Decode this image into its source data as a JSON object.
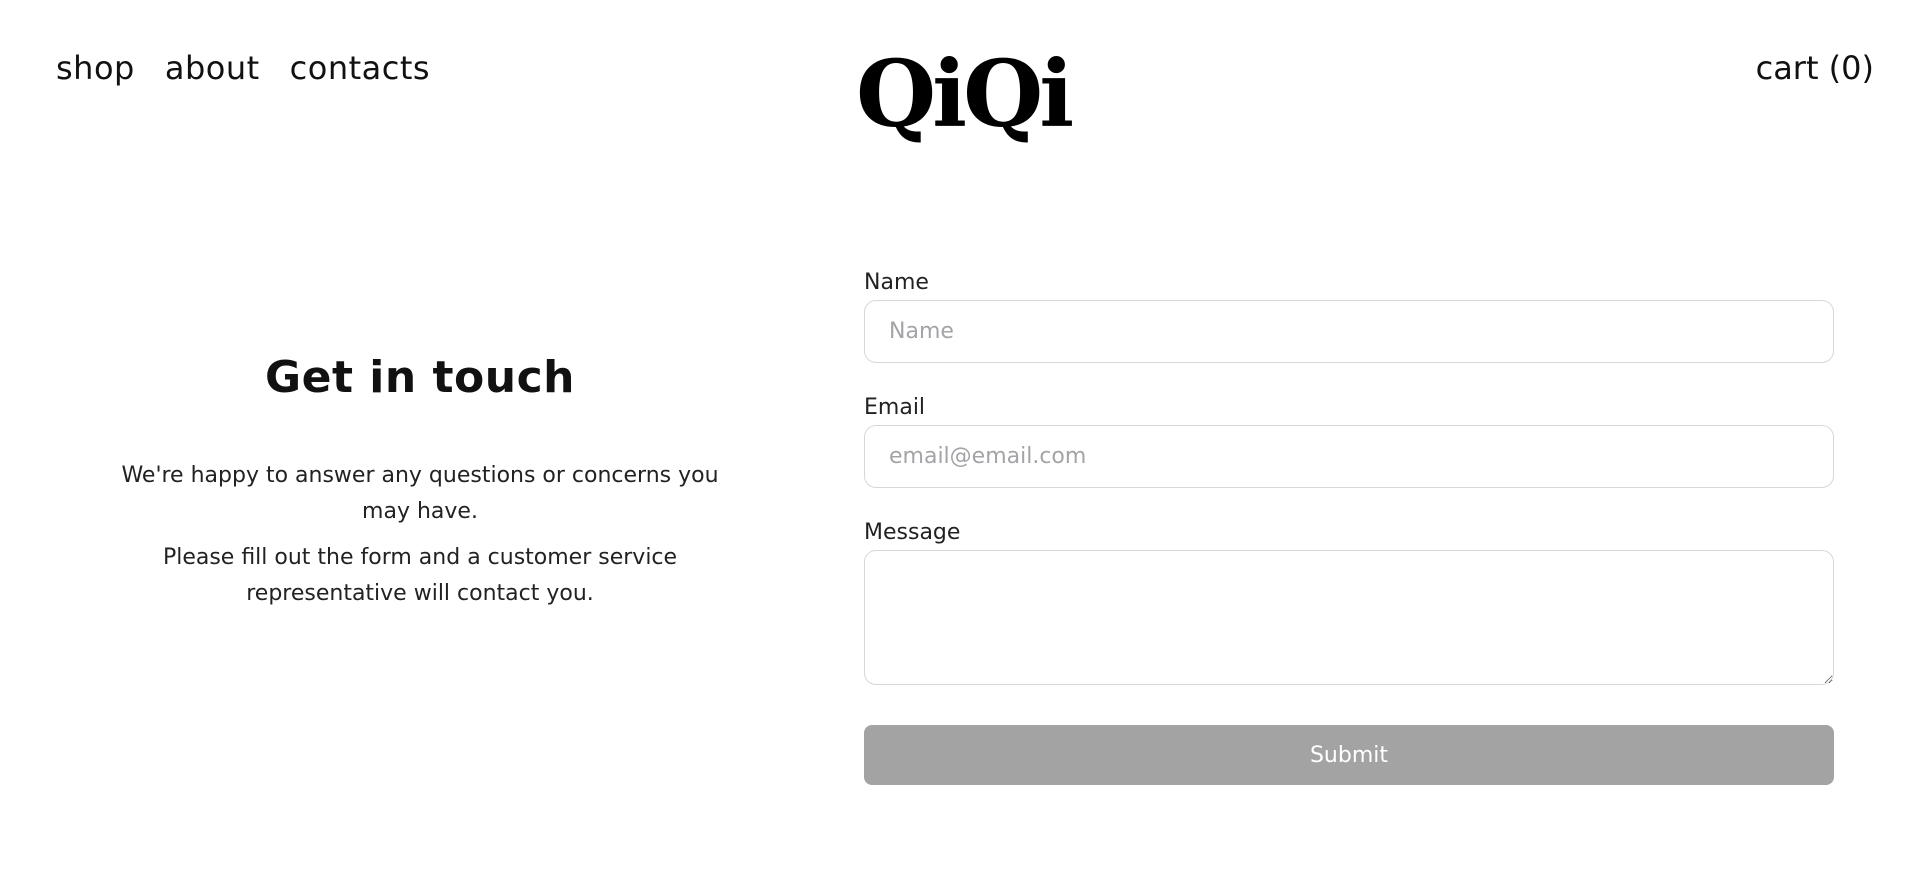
{
  "header": {
    "nav": [
      {
        "label": "shop"
      },
      {
        "label": "about"
      },
      {
        "label": "contacts"
      }
    ],
    "logo": "QiQi",
    "cart": "cart (0)"
  },
  "intro": {
    "title": "Get in touch",
    "paragraph_1": "We're happy to answer any questions or concerns you may have.",
    "paragraph_2": "Please fill out the form and a customer service representative will contact you."
  },
  "form": {
    "name": {
      "label": "Name",
      "placeholder": "Name",
      "value": ""
    },
    "email": {
      "label": "Email",
      "placeholder": "email@email.com",
      "value": ""
    },
    "message": {
      "label": "Message",
      "value": ""
    },
    "submit_label": "Submit"
  },
  "colors": {
    "text": "#111111",
    "input_border": "#d7d7d7",
    "placeholder": "#a4a4a8",
    "submit_bg": "#a3a3a3",
    "submit_text": "#ffffff"
  }
}
